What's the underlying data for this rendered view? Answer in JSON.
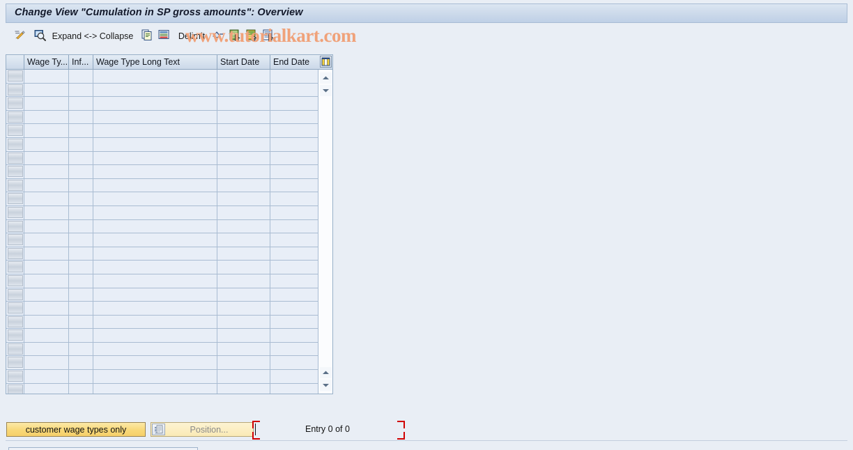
{
  "window": {
    "title": "Change View \"Cumulation in SP gross amounts\": Overview"
  },
  "toolbar": {
    "items": [
      {
        "name": "change-entry",
        "icon": "pencil-icon",
        "label": ""
      },
      {
        "name": "display-entry",
        "icon": "magnifier-display-icon",
        "label": ""
      },
      {
        "name": "expand-collapse",
        "icon": "",
        "label": "Expand <-> Collapse"
      },
      {
        "name": "copy-as",
        "icon": "copy-icon",
        "label": ""
      },
      {
        "name": "delete-row",
        "icon": "delete-row-icon",
        "label": ""
      },
      {
        "name": "delimit",
        "icon": "",
        "label": "Delimit"
      },
      {
        "name": "undo-delimit",
        "icon": "undo-delimit-icon",
        "label": ""
      },
      {
        "name": "select-all",
        "icon": "select-all-icon",
        "label": ""
      },
      {
        "name": "deselect-all",
        "icon": "deselect-all-icon",
        "label": ""
      },
      {
        "name": "select-block",
        "icon": "select-block-icon",
        "label": ""
      }
    ]
  },
  "watermark": {
    "text": "www.tutorialkart.com",
    "color": "#f0a27a"
  },
  "table": {
    "columns": [
      {
        "name": "selector",
        "label": ""
      },
      {
        "name": "wage-type",
        "label": "Wage Ty..."
      },
      {
        "name": "infotype",
        "label": "Inf..."
      },
      {
        "name": "wage-type-long-text",
        "label": "Wage Type Long Text"
      },
      {
        "name": "start-date",
        "label": "Start Date"
      },
      {
        "name": "end-date",
        "label": "End Date"
      }
    ],
    "rows": [],
    "row_count": 24,
    "config_icon": "table-settings-icon"
  },
  "footer": {
    "customer_button_label": "customer wage types only",
    "position_button_label": "Position...",
    "position_icon": "position-icon",
    "entry_status": "Entry 0 of 0"
  },
  "colors": {
    "accent": "#f6d06a",
    "grid_line": "#a9bcd2",
    "title_bg": "#cbd9ea",
    "bracket": "#d00000"
  }
}
